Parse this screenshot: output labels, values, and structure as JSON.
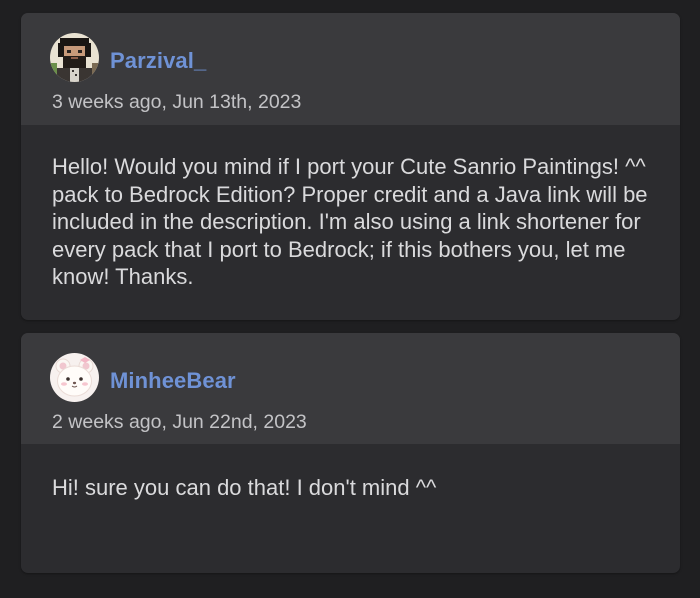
{
  "comments": [
    {
      "username": "Parzival_",
      "timestamp": "3 weeks ago, Jun 13th, 2023",
      "avatar_icon": "pixel-bearded-man-avatar-icon",
      "body": "Hello! Would you mind if I port your Cute Sanrio Paintings! ^^ pack to Bedrock Edition? Proper credit and a Java link will be included in the description. I'm also using a link shortener for every pack that I port to Bedrock; if this bothers you, let me know! Thanks."
    },
    {
      "username": "MinheeBear",
      "timestamp": "2 weeks ago, Jun 22nd, 2023",
      "avatar_icon": "cute-bear-avatar-icon",
      "body": "Hi! sure you can do that! I don't mind ^^"
    }
  ],
  "colors": {
    "background": "#1f1f21",
    "card": "#2c2c2f",
    "card_header": "#3a3a3d",
    "username": "#6f92d6",
    "text": "#dadadc",
    "timestamp": "#c3c3c6"
  }
}
